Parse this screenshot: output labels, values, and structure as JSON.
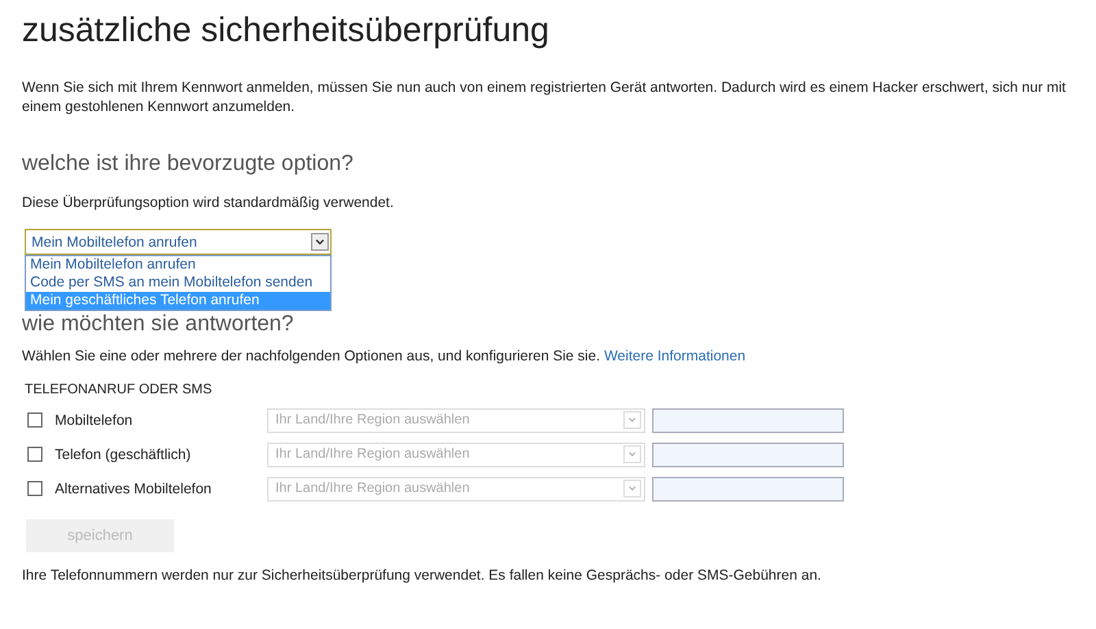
{
  "title": "zusätzliche sicherheitsüberprüfung",
  "intro": "Wenn Sie sich mit Ihrem Kennwort anmelden, müssen Sie nun auch von einem registrierten Gerät antworten. Dadurch wird es einem Hacker erschwert, sich nur mit einem gestohlenen Kennwort anzumelden.",
  "preferred": {
    "heading": "welche ist ihre bevorzugte option?",
    "hint": "Diese Überprüfungsoption wird standardmäßig verwendet.",
    "value": "Mein Mobiltelefon anrufen",
    "expanded": true,
    "options": [
      {
        "label": "Mein Mobiltelefon anrufen",
        "highlighted": false
      },
      {
        "label": "Code per SMS an mein Mobiltelefon senden",
        "highlighted": false
      },
      {
        "label": "Mein geschäftliches Telefon anrufen",
        "highlighted": true
      }
    ]
  },
  "answer": {
    "heading": "wie möchten sie antworten?",
    "info": "Wählen Sie eine oder mehrere der nachfolgenden Optionen aus, und konfigurieren Sie sie.",
    "link": "Weitere Informationen"
  },
  "section_label": "TELEFONANRUF ODER SMS",
  "phones": [
    {
      "label": "Mobiltelefon",
      "checked": false,
      "country_placeholder": "Ihr Land/Ihre Region auswählen"
    },
    {
      "label": "Telefon (geschäftlich)",
      "checked": false,
      "country_placeholder": "Ihr Land/Ihre Region auswählen"
    },
    {
      "label": "Alternatives Mobiltelefon",
      "checked": false,
      "country_placeholder": "Ihr Land/Ihre Region auswählen"
    }
  ],
  "save_button": {
    "label": "speichern",
    "disabled": true
  },
  "footer": "Ihre Telefonnummern werden nur zur Sicherheitsüberprüfung verwendet. Es fallen keine Gesprächs- oder SMS-Gebühren an."
}
